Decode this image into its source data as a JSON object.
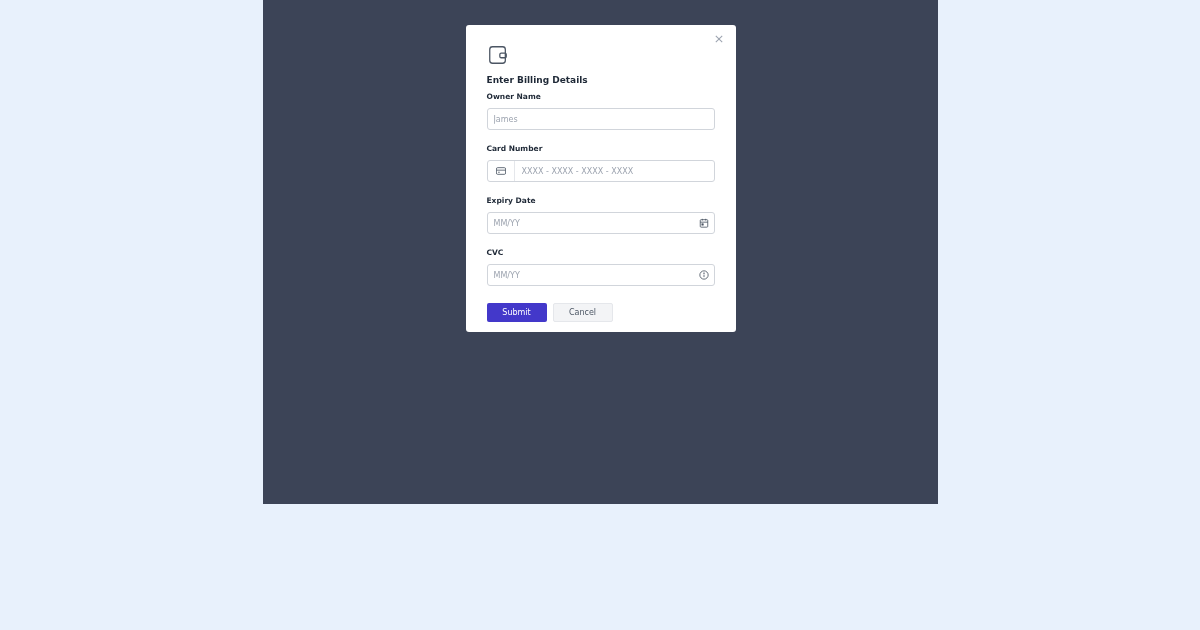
{
  "dialog": {
    "title": "Enter Billing Details",
    "fields": [
      {
        "label": "Owner Name",
        "placeholder": "James",
        "kind": "plain"
      },
      {
        "label": "Card Number",
        "placeholder": "XXXX - XXXX - XXXX - XXXX",
        "kind": "card"
      },
      {
        "label": "Expiry Date",
        "placeholder": "MM/YY",
        "kind": "date"
      },
      {
        "label": "CVC",
        "placeholder": "MM/YY",
        "kind": "info"
      }
    ],
    "buttons": [
      {
        "label": "Submit",
        "kind": "primary"
      },
      {
        "label": "Cancel",
        "kind": "secondary"
      }
    ]
  }
}
